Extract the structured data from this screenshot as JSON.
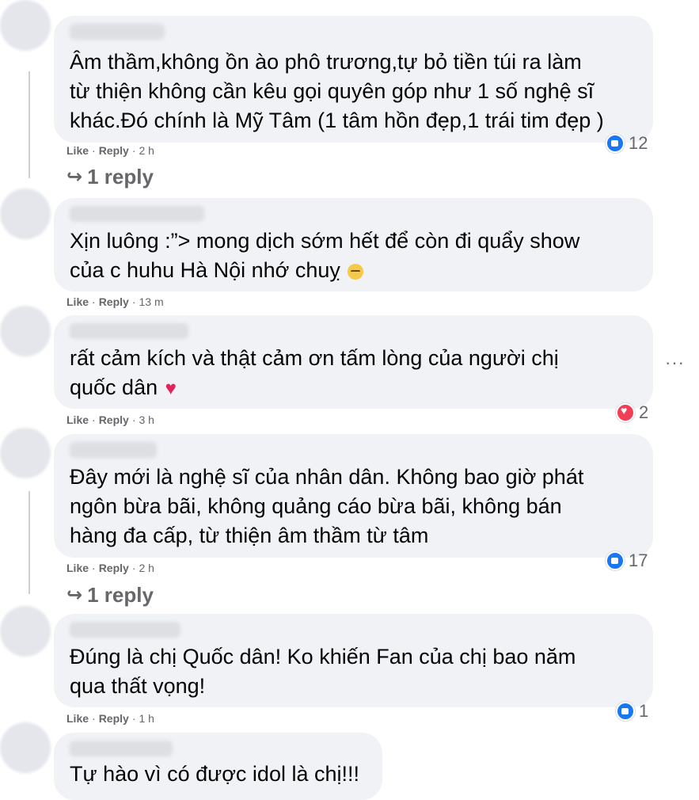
{
  "comments": [
    {
      "lines": [
        "Âm thầm,không ồn ào phô trương,tự bỏ tiền túi ra làm",
        "từ thiện không cần kêu gọi quyên góp như 1 số nghệ sĩ",
        "khác.Đó chính là Mỹ Tâm (1 tâm hồn đẹp,1 trái tim đẹp )"
      ],
      "like": "Like",
      "reply": "Reply",
      "time": "2 h",
      "reaction_type": "like",
      "reaction_count": "12",
      "replies_label": "1 reply"
    },
    {
      "lines": [
        "Xịn luông :”> mong dịch sớm hết để còn đi quẩy show",
        "của c huhu Hà Nội nhớ chuỵ"
      ],
      "emoji": "sad-face",
      "like": "Like",
      "reply": "Reply",
      "time": "13 m"
    },
    {
      "lines": [
        "rất cảm kích và thật cảm ơn tấm lòng của người chị",
        "quốc dân"
      ],
      "emoji": "red-heart",
      "like": "Like",
      "reply": "Reply",
      "time": "3 h",
      "reaction_type": "love",
      "reaction_count": "2"
    },
    {
      "lines": [
        "Đây mới là nghệ sĩ của nhân dân. Không bao giờ phát",
        "ngôn bừa bãi, không quảng cáo bừa bãi, không bán",
        "hàng đa cấp, từ thiện âm thầm từ tâm"
      ],
      "like": "Like",
      "reply": "Reply",
      "time": "2 h",
      "reaction_type": "like",
      "reaction_count": "17",
      "replies_label": "1 reply"
    },
    {
      "lines": [
        "Đúng là chị Quốc dân! Ko khiến Fan của chị bao năm",
        "qua thất vọng!"
      ],
      "like": "Like",
      "reply": "Reply",
      "time": "1 h",
      "reaction_type": "like",
      "reaction_count": "1"
    },
    {
      "lines": [
        "Tự hào vì có được idol là chị!!!"
      ]
    }
  ],
  "more_label": "···",
  "separator": "·",
  "colors": {
    "bubble": "#f0f2f5",
    "meta": "#65676b",
    "like_blue": "#1877f2",
    "love_red": "#f33e58"
  }
}
